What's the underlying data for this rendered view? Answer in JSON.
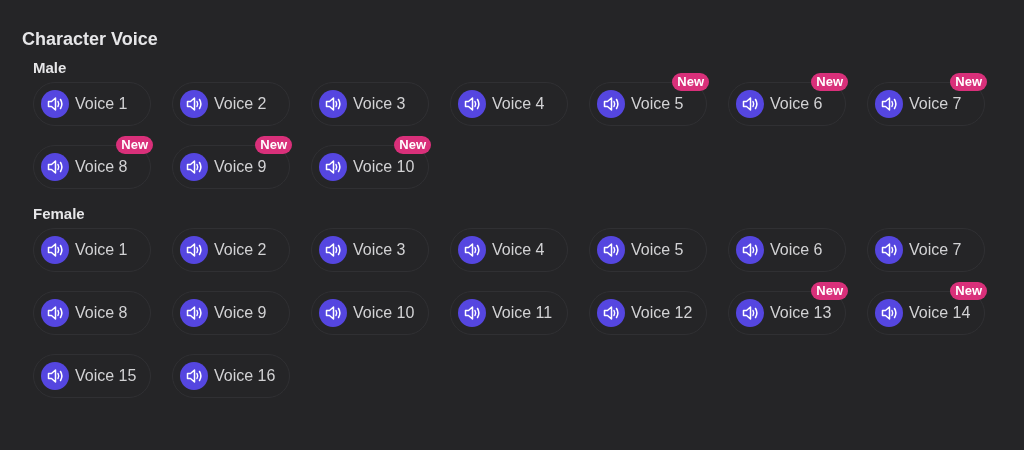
{
  "title": "Character Voice",
  "groups": [
    {
      "label": "Male",
      "voices": [
        {
          "name": "Voice 1"
        },
        {
          "name": "Voice 2"
        },
        {
          "name": "Voice 3"
        },
        {
          "name": "Voice 4"
        },
        {
          "name": "Voice 5",
          "badge": "New"
        },
        {
          "name": "Voice 6",
          "badge": "New"
        },
        {
          "name": "Voice 7",
          "badge": "New"
        },
        {
          "name": "Voice 8",
          "badge": "New"
        },
        {
          "name": "Voice 9",
          "badge": "New"
        },
        {
          "name": "Voice 10",
          "badge": "New"
        }
      ]
    },
    {
      "label": "Female",
      "voices": [
        {
          "name": "Voice 1"
        },
        {
          "name": "Voice 2"
        },
        {
          "name": "Voice 3"
        },
        {
          "name": "Voice 4"
        },
        {
          "name": "Voice 5"
        },
        {
          "name": "Voice 6"
        },
        {
          "name": "Voice 7"
        },
        {
          "name": "Voice 8"
        },
        {
          "name": "Voice 9"
        },
        {
          "name": "Voice 10"
        },
        {
          "name": "Voice 11"
        },
        {
          "name": "Voice 12"
        },
        {
          "name": "Voice 13",
          "badge": "New"
        },
        {
          "name": "Voice 14",
          "badge": "New"
        },
        {
          "name": "Voice 15"
        },
        {
          "name": "Voice 16"
        }
      ]
    }
  ]
}
